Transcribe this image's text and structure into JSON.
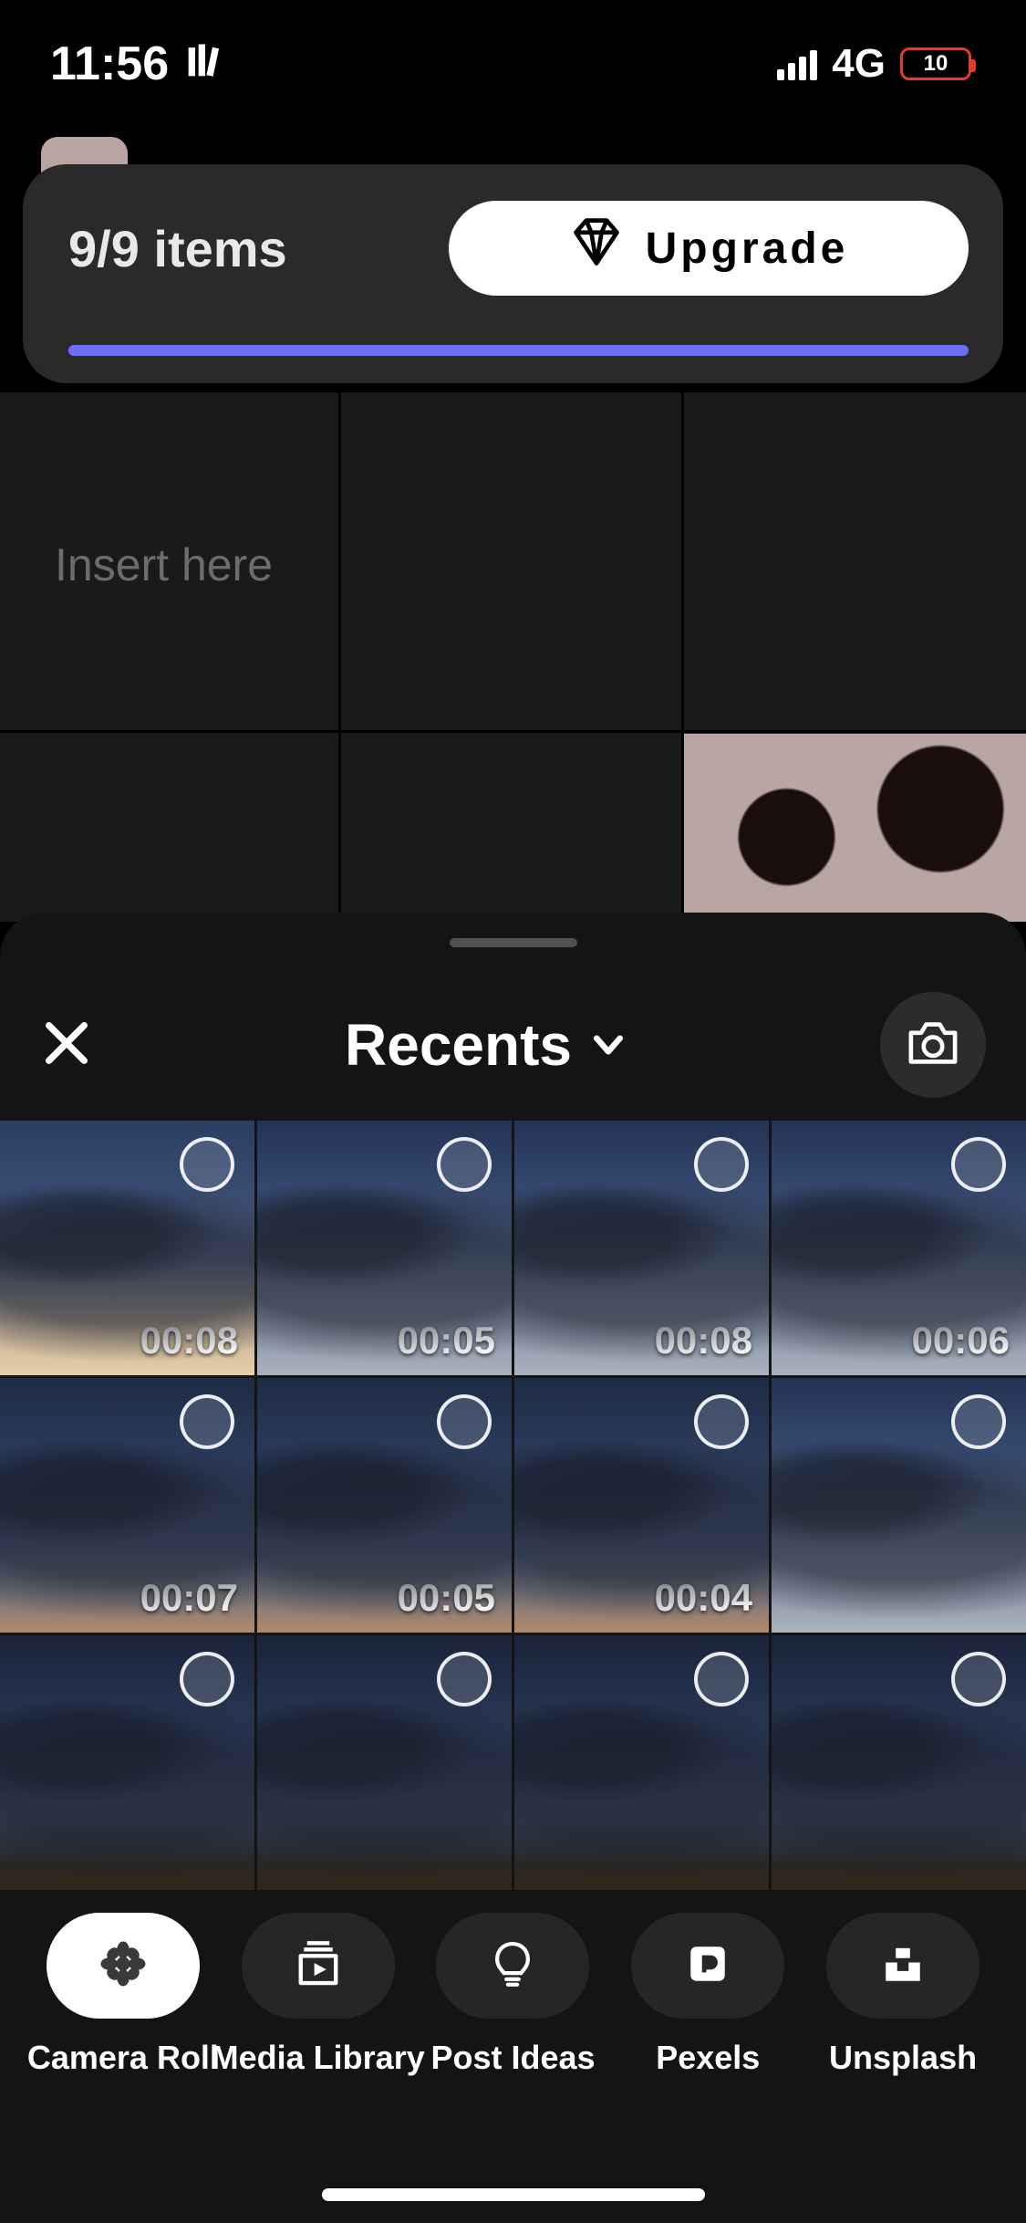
{
  "status_bar": {
    "time": "11:56",
    "network_type": "4G",
    "battery_percent": "10"
  },
  "upgrade_banner": {
    "items_text": "9/9 items",
    "button_label": "Upgrade",
    "progress_percent": 100
  },
  "canvas": {
    "placeholder": "Insert here"
  },
  "picker": {
    "album_title": "Recents"
  },
  "thumbnails": [
    {
      "duration": "00:08",
      "sky": "a"
    },
    {
      "duration": "00:05",
      "sky": "b"
    },
    {
      "duration": "00:08",
      "sky": "b"
    },
    {
      "duration": "00:06",
      "sky": "b"
    },
    {
      "duration": "00:07",
      "sky": "c"
    },
    {
      "duration": "00:05",
      "sky": "c"
    },
    {
      "duration": "00:04",
      "sky": "c"
    },
    {
      "duration": "",
      "sky": "b"
    },
    {
      "duration": "",
      "sky": "d"
    },
    {
      "duration": "",
      "sky": "d"
    },
    {
      "duration": "",
      "sky": "d"
    },
    {
      "duration": "",
      "sky": "d"
    }
  ],
  "sources": [
    {
      "id": "camera-roll",
      "label": "Camera Roll",
      "active": true
    },
    {
      "id": "media-library",
      "label": "Media Library",
      "active": false
    },
    {
      "id": "post-ideas",
      "label": "Post Ideas",
      "active": false
    },
    {
      "id": "pexels",
      "label": "Pexels",
      "active": false
    },
    {
      "id": "unsplash",
      "label": "Unsplash",
      "active": false
    }
  ]
}
